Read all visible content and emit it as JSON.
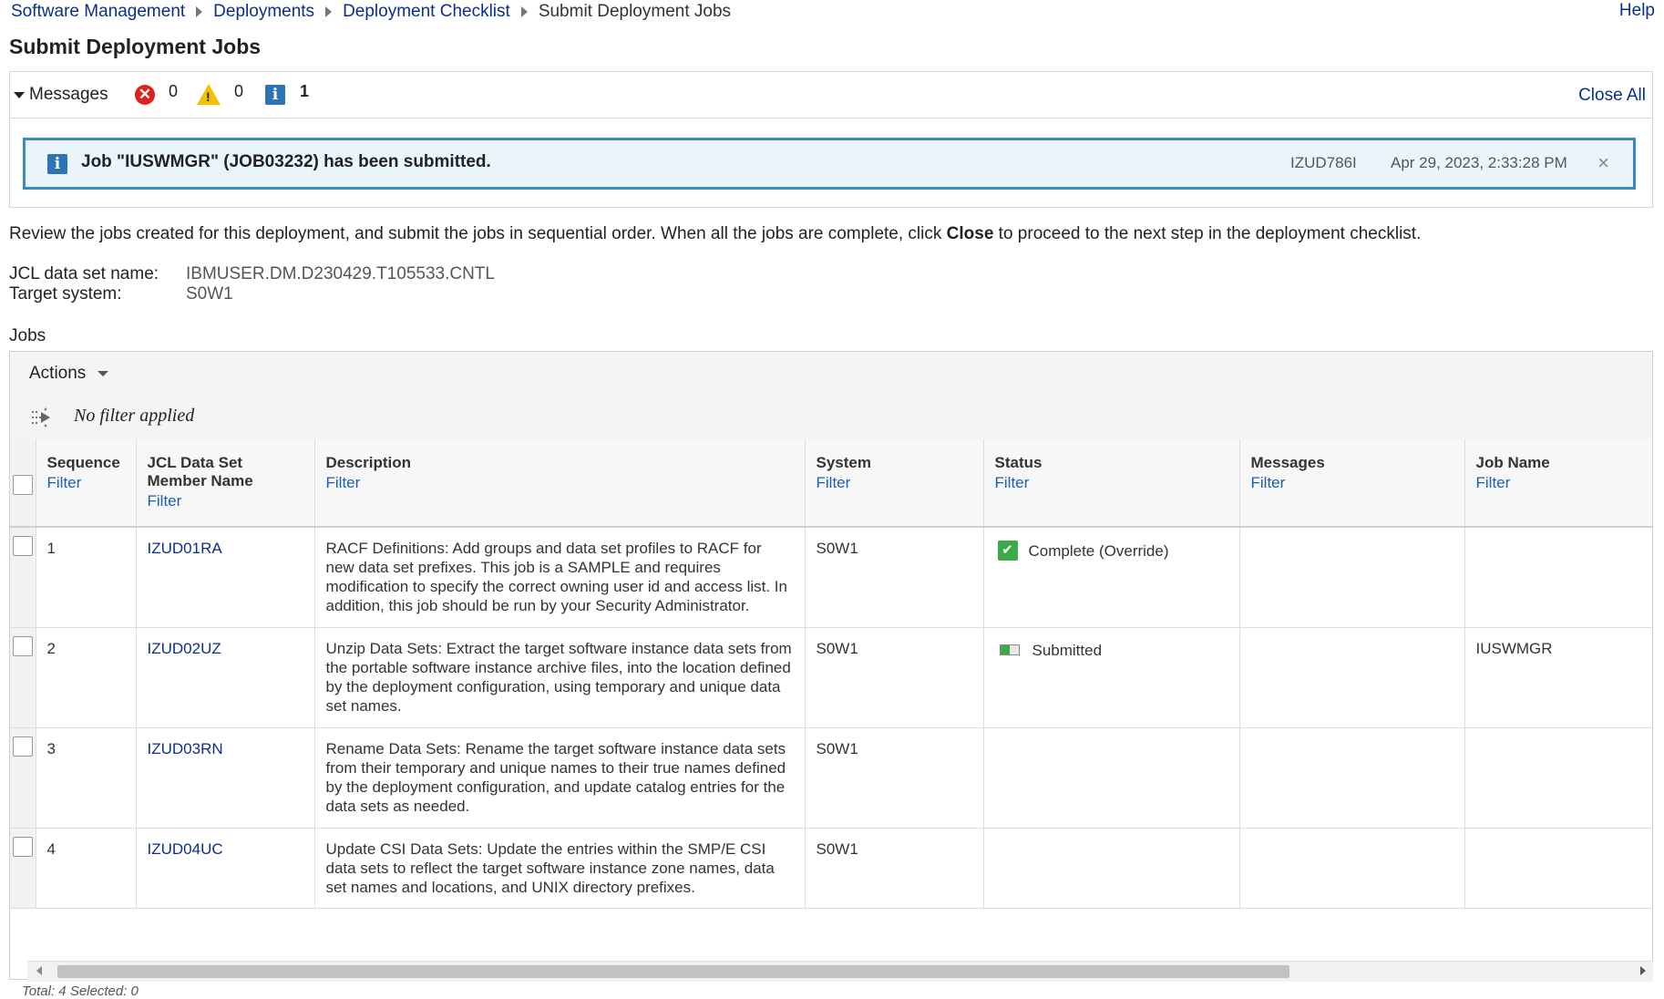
{
  "breadcrumb": {
    "items": [
      "Software Management",
      "Deployments",
      "Deployment Checklist"
    ],
    "current": "Submit Deployment Jobs"
  },
  "help_label": "Help",
  "page_title": "Submit Deployment Jobs",
  "messages": {
    "label": "Messages",
    "error_count": "0",
    "warning_count": "0",
    "info_count": "1",
    "close_all": "Close All",
    "items": [
      {
        "text": "Job \"IUSWMGR\" (JOB03232) has been submitted.",
        "id": "IZUD786I",
        "timestamp": "Apr 29, 2023, 2:33:28 PM",
        "close_glyph": "×"
      }
    ]
  },
  "intro": {
    "before": "Review the jobs created for this deployment, and submit the jobs in sequential order. When all the jobs are complete, click ",
    "bold": "Close",
    "after": " to proceed to the next step in the deployment checklist."
  },
  "details": {
    "jcl_label": "JCL data set name:",
    "jcl_value": "IBMUSER.DM.D230429.T105533.CNTL",
    "target_label": "Target system:",
    "target_value": "S0W1"
  },
  "jobs_label": "Jobs",
  "toolbar": {
    "actions_label": "Actions"
  },
  "filter_status": "No filter applied",
  "columns": [
    {
      "title": "Sequence",
      "filter": "Filter"
    },
    {
      "title": "JCL Data Set Member Name",
      "filter": "Filter"
    },
    {
      "title": "Description",
      "filter": "Filter"
    },
    {
      "title": "System",
      "filter": "Filter"
    },
    {
      "title": "Status",
      "filter": "Filter"
    },
    {
      "title": "Messages",
      "filter": "Filter"
    },
    {
      "title": "Job Name",
      "filter": "Filter"
    }
  ],
  "rows": [
    {
      "sequence": "1",
      "member": "IZUD01RA",
      "description": "RACF Definitions: Add groups and data set profiles to RACF for new data set prefixes. This job is a SAMPLE and requires modification to specify the correct owning user id and access list. In addition, this job should be run by your Security Administrator.",
      "system": "S0W1",
      "status": "Complete (Override)",
      "status_icon": "check-icon",
      "messages": "",
      "job_name": ""
    },
    {
      "sequence": "2",
      "member": "IZUD02UZ",
      "description": "Unzip Data Sets: Extract the target software instance data sets from the portable software instance archive files, into the location defined by the deployment configuration, using temporary and unique data set names.",
      "system": "S0W1",
      "status": "Submitted",
      "status_icon": "progress-icon",
      "messages": "",
      "job_name": "IUSWMGR"
    },
    {
      "sequence": "3",
      "member": "IZUD03RN",
      "description": "Rename Data Sets: Rename the target software instance data sets from their temporary and unique names to their true names defined by the deployment configuration, and update catalog entries for the data sets as needed.",
      "system": "S0W1",
      "status": "",
      "status_icon": "",
      "messages": "",
      "job_name": ""
    },
    {
      "sequence": "4",
      "member": "IZUD04UC",
      "description": "Update CSI Data Sets: Update the entries within the SMP/E CSI data sets to reflect the target software instance zone names, data set names and locations, and UNIX directory prefixes.",
      "system": "S0W1",
      "status": "",
      "status_icon": "",
      "messages": "",
      "job_name": ""
    }
  ],
  "footer_text": "Total: 4 Selected: 0",
  "colors": {
    "link": "#0b2f87",
    "filter_link": "#1b5fa8",
    "info_border": "#3a8bbf",
    "info_bg": "#eaf5fb",
    "error": "#e02020",
    "warning": "#f2c200",
    "success": "#3aaa4a"
  }
}
